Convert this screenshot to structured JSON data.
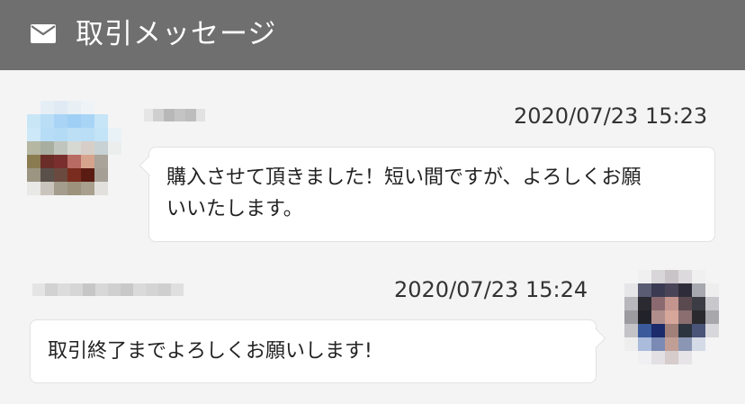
{
  "header": {
    "title": "取引メッセージ",
    "icon": "mail-icon",
    "background": "#6f6f6f"
  },
  "messages": [
    {
      "timestamp": "2020/07/23 15:23",
      "text": "購入させて頂きました！短い間ですが、よろしくお願\nいいたします。",
      "side": "left",
      "sender_name_visible": false
    },
    {
      "timestamp": "2020/07/23 15:24",
      "text": "取引終了までよろしくお願いします!",
      "side": "right",
      "sender_name_visible": false
    }
  ]
}
